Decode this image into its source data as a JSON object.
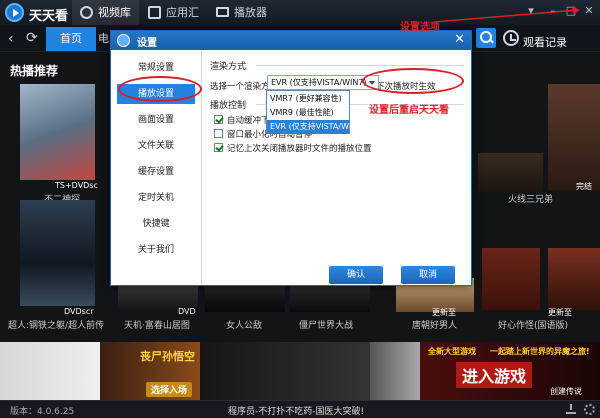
{
  "app": {
    "title": "天天看",
    "nav_tabs": [
      {
        "label": "视频库",
        "icon": "video-library-icon"
      },
      {
        "label": "应用汇",
        "icon": "apps-icon"
      },
      {
        "label": "播放器",
        "icon": "player-icon"
      }
    ]
  },
  "navbar": {
    "home_tab": "首页",
    "next_tab": "电",
    "history_label": "观看记录"
  },
  "content": {
    "section_title": "热播推荐",
    "posters": [
      {
        "title": "不二神探",
        "badge": "TS+DVDsc"
      },
      {
        "title": "超人:钢铁之躯/超人前传",
        "badge": "DVDscr"
      },
      {
        "title": "天机·富春山居图",
        "badge": "DVD"
      },
      {
        "title": "女人公敌",
        "badge": ""
      },
      {
        "title": "僵尸世界大战",
        "badge": ""
      },
      {
        "title": "唐朝好男人",
        "badge": "更新至"
      },
      {
        "title": "好心作怪(国语版)",
        "badge": "更新至"
      },
      {
        "title": "火线三兄弟",
        "badge": "完结"
      }
    ]
  },
  "banners": {
    "b2_title": "丧尸孙悟空",
    "b2_button": "选择入场",
    "b5_top": "全新大型游戏",
    "b5_sub": "一起踏上新世界的异魔之旅!",
    "b5_title": "进入游戏",
    "b5_link": "创建传说"
  },
  "statusbar": {
    "version": "版本：4.0.6.25",
    "ticker": "程序员-不打扑不吃药-国医大突破!"
  },
  "annotations": {
    "settings_hint": "设置选项",
    "restart_hint": "设置后重启天天看"
  },
  "dialog": {
    "title": "设置",
    "sidebar": [
      "常规设置",
      "播放设置",
      "画面设置",
      "文件关联",
      "缓存设置",
      "定时关机",
      "快捷键",
      "关于我们"
    ],
    "active_index": 1,
    "render_group": "渲染方式",
    "render_label": "选择一个渲染方式",
    "render_selected": "EVR (仅支持VISTA/WIN7)",
    "render_note": "下次播放时生效",
    "render_options": [
      "VMR7 (更好兼容性)",
      "VMR9 (最佳性能)",
      "EVR (仅支持VISTA/WIN7)"
    ],
    "control_group": "播放控制",
    "checkboxes": [
      {
        "label": "自动缓冲下",
        "checked": true
      },
      {
        "label": "窗口最小化时自动暂停",
        "checked": false
      },
      {
        "label": "记忆上次关闭播放器时文件的播放位置",
        "checked": true
      }
    ],
    "ok_button": "确认",
    "cancel_button": "取消"
  },
  "colors": {
    "accent": "#2283e0",
    "annotation": "#d81e26"
  }
}
